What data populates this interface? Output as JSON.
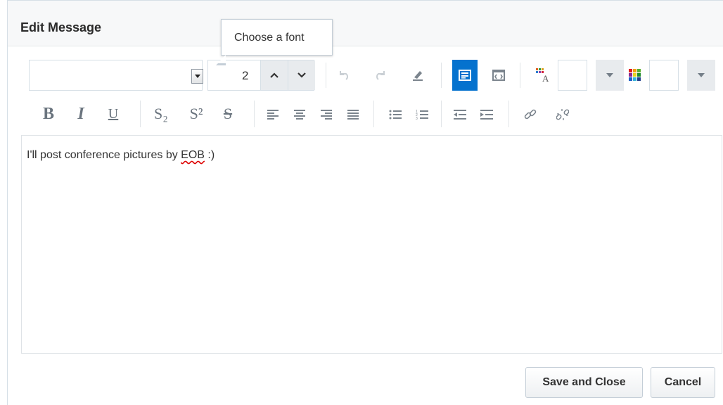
{
  "dialog": {
    "title": "Edit Message",
    "tooltip": "Choose a font"
  },
  "toolbar": {
    "font_name": "",
    "font_size": "2",
    "icons_row1": [
      "undo-icon",
      "redo-icon",
      "clear-formatting-icon",
      "rich-text-mode-icon",
      "code-view-icon",
      "text-color-icon",
      "background-color-icon"
    ],
    "icons_row2": [
      "bold-icon",
      "italic-icon",
      "underline-icon",
      "subscript-icon",
      "superscript-icon",
      "strikethrough-icon",
      "align-left-icon",
      "align-center-icon",
      "align-right-icon",
      "justify-icon",
      "bulleted-list-icon",
      "numbered-list-icon",
      "outdent-icon",
      "indent-icon",
      "link-icon",
      "unlink-icon"
    ],
    "bold_label": "B",
    "italic_label": "I",
    "underline_label": "U",
    "subscript_label": "S₂",
    "superscript_label": "S²",
    "strike_label": "S"
  },
  "editor": {
    "text_before": "I'll post conference pictures by ",
    "misspelled_word": "EOB",
    "text_after": " :)"
  },
  "buttons": {
    "save_close": "Save and Close",
    "cancel": "Cancel"
  },
  "colors": {
    "accent": "#0572ce",
    "border": "#d6dfe6",
    "icon": "#6f7983"
  }
}
